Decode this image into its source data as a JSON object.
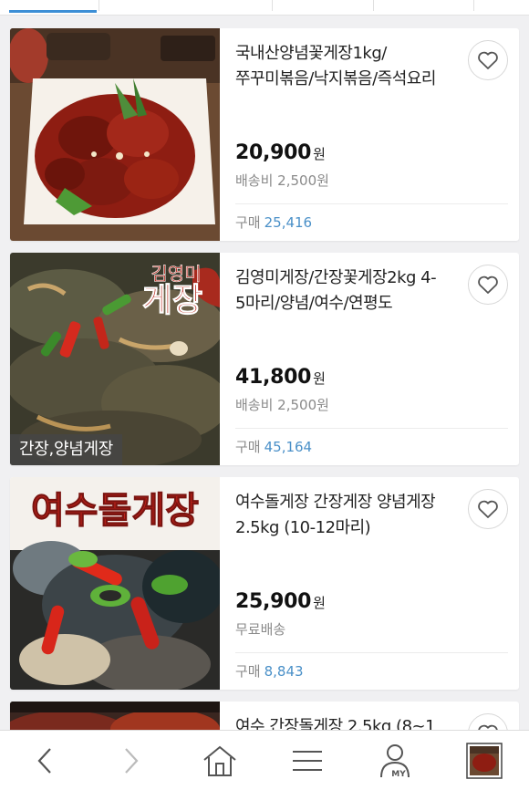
{
  "colors": {
    "accent": "#3d8fd6",
    "count_link": "#4a90c8",
    "muted": "#8a8a8a"
  },
  "products": [
    {
      "title": "국내산양념꽃게장1kg/쭈꾸미볶음/낙지볶음/즉석요리",
      "price": "20,900",
      "currency": "원",
      "shipping": "배송비 2,500원",
      "purchase_label": "구매",
      "purchase_count": "25,416",
      "image": "spicy-marinated-crab-photo"
    },
    {
      "title": "김영미게장/간장꽃게장2kg 4-5마리/양념/여수/연평도",
      "price": "41,800",
      "currency": "원",
      "shipping": "배송비 2,500원",
      "purchase_label": "구매",
      "purchase_count": "45,164",
      "image": "soy-sauce-crab-photo",
      "image_text_line1": "김영미",
      "image_text_line2": "게장",
      "overlay_label": "간장,양념게장"
    },
    {
      "title": "여수돌게장 간장게장 양념게장 2.5kg (10-12마리)",
      "price": "25,900",
      "currency": "원",
      "shipping": "무료배송",
      "purchase_label": "구매",
      "purchase_count": "8,843",
      "image": "yeosu-stone-crab-photo",
      "image_text": "여수돌게장"
    },
    {
      "title": "여수 간장돌게장 2.5kg (8~1",
      "image": "partial-crab-photo"
    }
  ],
  "bottom_nav": {
    "back": "back-icon",
    "forward": "forward-icon",
    "home": "home-icon",
    "menu": "menu-icon",
    "my_label": "MY",
    "recent": "recent-item-thumbnail"
  }
}
